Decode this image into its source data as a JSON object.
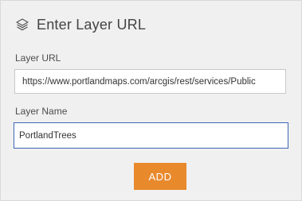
{
  "dialog": {
    "title": "Enter Layer URL",
    "icon": "layers-icon"
  },
  "fields": {
    "url": {
      "label": "Layer URL",
      "value": "https://www.portlandmaps.com/arcgis/rest/services/Public"
    },
    "name": {
      "label": "Layer Name",
      "value": "PortlandTrees"
    }
  },
  "actions": {
    "add_label": "ADD"
  },
  "colors": {
    "accent_button": "#e8892c",
    "focus_border": "#3d66b3",
    "panel_background": "#f0f0f0"
  }
}
